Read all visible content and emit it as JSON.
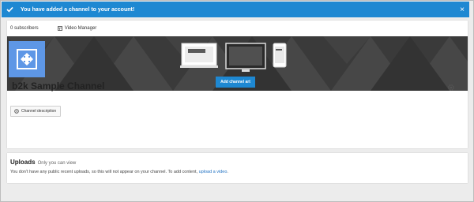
{
  "notice": {
    "message": "You have added a channel to your account!",
    "close_glyph": "×",
    "bg_color": "#1e88d2"
  },
  "channel": {
    "subscribers": "0 subscribers",
    "video_manager": "Video Manager",
    "add_art_label": "Add channel art",
    "title": "b2k Sample Channel",
    "description_button": "Channel description",
    "avatar_color": "#5e97e6"
  },
  "uploads": {
    "title": "Uploads",
    "visibility": "Only you can view",
    "message": "You don't have any public recent uploads, so this will not appear on your channel. To add content,",
    "link": "upload a video",
    "end": "."
  },
  "icons": [
    "check-icon",
    "close-icon",
    "video-manager-icon",
    "avatar-placeholder-icon",
    "laptop-icon",
    "tv-icon",
    "phone-icon",
    "gear-icon",
    "description-icon"
  ]
}
